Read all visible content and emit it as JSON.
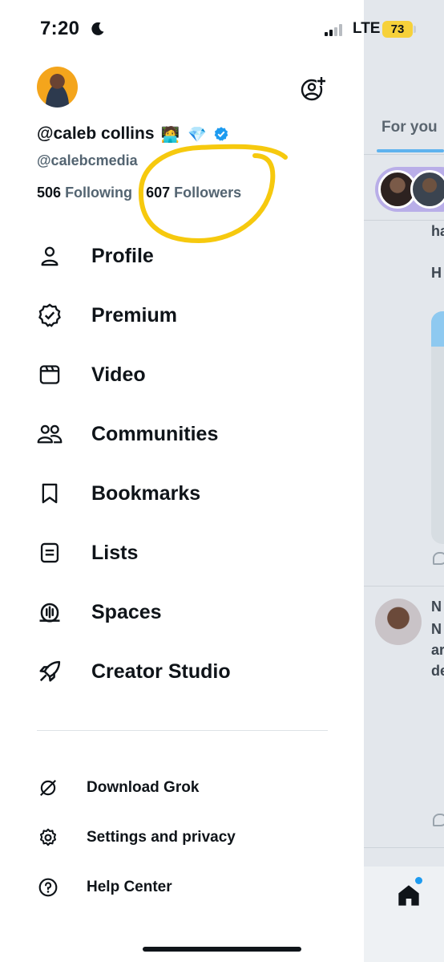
{
  "status_bar": {
    "time": "7:20",
    "network": "LTE",
    "battery": "73",
    "icons": [
      "moon-icon",
      "signal-icon",
      "battery-icon"
    ]
  },
  "profile": {
    "display_name": "@caleb collins",
    "name_emoji": "🧑‍💻",
    "name_diamond": "💎",
    "handle": "@calebcmedia",
    "following_count": "506",
    "following_label": "Following",
    "followers_count": "607",
    "followers_label": "Followers",
    "verified_color": "#1d9bf0",
    "annotation_color": "#f6c90e"
  },
  "menu": [
    {
      "label": "Profile",
      "icon": "person-icon"
    },
    {
      "label": "Premium",
      "icon": "verified-badge-icon"
    },
    {
      "label": "Video",
      "icon": "video-icon"
    },
    {
      "label": "Communities",
      "icon": "communities-icon"
    },
    {
      "label": "Bookmarks",
      "icon": "bookmark-icon"
    },
    {
      "label": "Lists",
      "icon": "list-icon"
    },
    {
      "label": "Spaces",
      "icon": "spaces-icon"
    },
    {
      "label": "Creator Studio",
      "icon": "rocket-icon"
    }
  ],
  "secondary_menu": [
    {
      "label": "Download Grok",
      "icon": "grok-icon"
    },
    {
      "label": "Settings and privacy",
      "icon": "gear-icon"
    },
    {
      "label": "Help Center",
      "icon": "help-icon"
    }
  ],
  "timeline": {
    "tab_label": "For you",
    "accent": "#1d9bf0",
    "nav_icon": "home-icon"
  }
}
